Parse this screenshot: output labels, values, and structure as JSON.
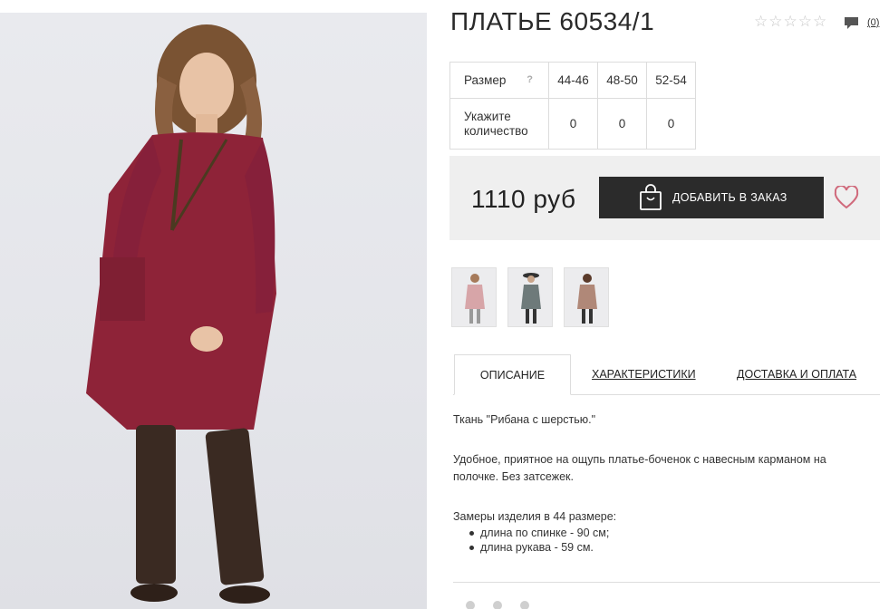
{
  "product": {
    "title": "ПЛАТЬЕ 60534/1",
    "rating_stars": 5,
    "rating_filled": 0,
    "comments_count": "(0)"
  },
  "size_table": {
    "size_label": "Размер",
    "help": "?",
    "qty_label": "Укажите количество",
    "sizes": [
      "44-46",
      "48-50",
      "52-54"
    ],
    "quantities": [
      "0",
      "0",
      "0"
    ]
  },
  "purchase": {
    "price": "1110 руб",
    "add_button": "ДОБАВИТЬ В ЗАКАЗ"
  },
  "tabs": [
    "ОПИСАНИЕ",
    "ХАРАКТЕРИСТИКИ",
    "ДОСТАВКА И ОПЛАТА"
  ],
  "description": {
    "p1": "Ткань \"Рибана с шерстью.\"",
    "p2": "Удобное, приятное на ощупь платье-боченок с навесным карманом на полочке. Без затсежек.",
    "p3": "Замеры изделия в 44 размере:",
    "bullets": [
      "длина по спинке - 90 см;",
      "длина рукава - 59 см."
    ]
  },
  "colors": {
    "dress": "#8e2338",
    "boots": "#3a2a22",
    "button": "#2b2b2b",
    "heart": "#d06a7c"
  }
}
